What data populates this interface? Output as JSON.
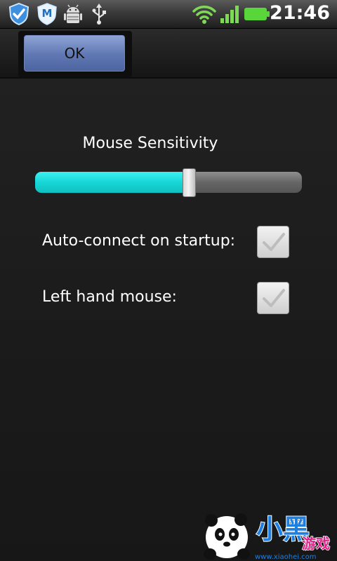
{
  "status_bar": {
    "icons": [
      "shield-check-icon",
      "antivirus-icon",
      "android-debug-icon",
      "usb-icon",
      "wifi-icon",
      "signal-icon",
      "battery-icon"
    ],
    "time": "21:46"
  },
  "toolbar": {
    "ok_label": "OK"
  },
  "settings": {
    "sensitivity_label": "Mouse Sensitivity",
    "sensitivity_value": 0.58,
    "options": [
      {
        "label": "Auto-connect on startup:",
        "checked": true
      },
      {
        "label": "Left hand mouse:",
        "checked": true
      }
    ]
  },
  "watermark": {
    "brand": "小黑游戏",
    "url": "www.xiaohei.com"
  }
}
